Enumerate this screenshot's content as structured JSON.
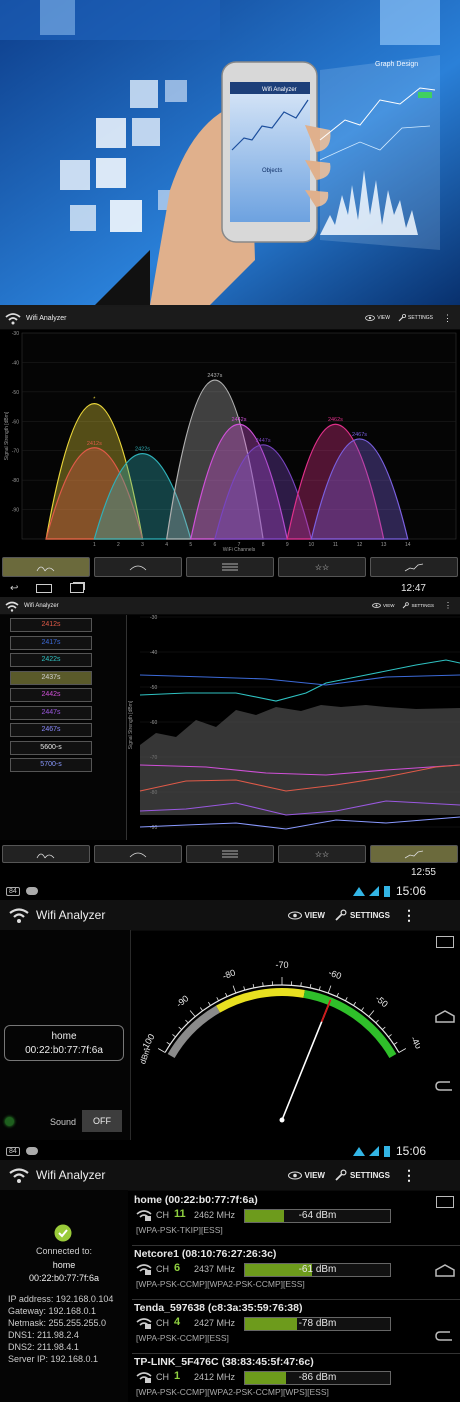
{
  "header_image": {
    "graph_design_label": "Graph Design",
    "screen_header": "Wifi Analyzer",
    "screen_label": "Objects"
  },
  "panel1": {
    "app_title": "Wifi Analyzer",
    "view_label": "VIEW",
    "settings_label": "SETTINGS",
    "ylabel": "Signal Strength [dBm]",
    "xlabel": "WiFi Channels",
    "time": "12:47"
  },
  "chart_data": {
    "type": "area",
    "title": "",
    "xlabel": "WiFi Channels",
    "ylabel": "Signal Strength [dBm]",
    "ylim": [
      -100,
      -30
    ],
    "xlim": [
      -2,
      16
    ],
    "x_ticks": [
      "1",
      "2",
      "3",
      "4",
      "5",
      "6",
      "7",
      "8",
      "9",
      "10",
      "11",
      "12",
      "13",
      "14"
    ],
    "y_ticks": [
      "-30",
      "-40",
      "-50",
      "-60",
      "-70",
      "-80",
      "-90"
    ],
    "series": [
      {
        "name": "*",
        "channel": 1,
        "peak": -54,
        "color": "#e8d43a"
      },
      {
        "name": "2412s",
        "channel": 1,
        "peak": -69,
        "color": "#e05a48"
      },
      {
        "name": "2422s",
        "channel": 3,
        "peak": -71,
        "color": "#2fb0b8"
      },
      {
        "name": "2437s",
        "channel": 6,
        "peak": -46,
        "color": "#b0b0b0"
      },
      {
        "name": "2442s",
        "channel": 7,
        "peak": -61,
        "color": "#d050d8"
      },
      {
        "name": "2447s",
        "channel": 8,
        "peak": -68,
        "color": "#7844c0"
      },
      {
        "name": "2462s",
        "channel": 11,
        "peak": -61,
        "color": "#e0308a"
      },
      {
        "name": "2467s",
        "channel": 12,
        "peak": -66,
        "color": "#7a60e0"
      }
    ]
  },
  "panel2": {
    "app_title": "Wifi Analyzer",
    "view_label": "VIEW",
    "settings_label": "SETTINGS",
    "ylabel": "Signal Strength [dBm]",
    "y_ticks": [
      "-30",
      "-40",
      "-50",
      "-60",
      "-70",
      "-80",
      "-90"
    ],
    "time": "12:55",
    "legend": [
      {
        "label": "2412s",
        "color": "#e05a48"
      },
      {
        "label": "2417s",
        "color": "#3c6ad8"
      },
      {
        "label": "2422s",
        "color": "#2fc2c2"
      },
      {
        "label": "2437s",
        "color": "#d0d0d0"
      },
      {
        "label": "2442s",
        "color": "#d050d8"
      },
      {
        "label": "2447s",
        "color": "#9a58e0"
      },
      {
        "label": "2467s",
        "color": "#8a8aff"
      },
      {
        "label": "5600-s",
        "color": "#e8e8e8"
      },
      {
        "label": "5700-s",
        "color": "#8a9aff"
      }
    ]
  },
  "panel3": {
    "app_title": "Wifi Analyzer",
    "view_label": "VIEW",
    "settings_label": "SETTINGS",
    "time": "15:06",
    "badge": "84",
    "ssid": "home",
    "bssid": "00:22:b0:77:7f:6a",
    "sound_label": "Sound",
    "sound_toggle": "OFF",
    "dbm_label": "dBm",
    "scale": [
      "-100",
      "-90",
      "-80",
      "-70",
      "-60",
      "-50",
      "-40"
    ],
    "needle_dbm": -59
  },
  "panel4": {
    "app_title": "Wifi Analyzer",
    "view_label": "VIEW",
    "settings_label": "SETTINGS",
    "time": "15:06",
    "badge": "84",
    "connected_label": "Connected to:",
    "connected_ssid": "home",
    "connected_bssid": "00:22:b0:77:7f:6a",
    "ip": "IP address: 192.168.0.104",
    "gateway": "Gateway: 192.168.0.1",
    "netmask": "Netmask: 255.255.255.0",
    "dns1": "DNS1: 211.98.2.4",
    "dns2": "DNS2: 211.98.4.1",
    "server": "Server IP: 192.168.0.1",
    "networks": [
      {
        "name": "home (00:22:b0:77:7f:6a)",
        "ch_label": "CH",
        "ch": "11",
        "freq": "2462 MHz",
        "dbm": "-64 dBm",
        "level": 0.27,
        "security": "[WPA-PSK-TKIP][ESS]"
      },
      {
        "name": "Netcore1 (08:10:76:27:26:3c)",
        "ch_label": "CH",
        "ch": "6",
        "freq": "2437 MHz",
        "dbm": "-61 dBm",
        "level": 0.46,
        "security": "[WPA-PSK-CCMP][WPA2-PSK-CCMP][ESS]"
      },
      {
        "name": "Tenda_597638 (c8:3a:35:59:76:38)",
        "ch_label": "CH",
        "ch": "4",
        "freq": "2427 MHz",
        "dbm": "-78 dBm",
        "level": 0.36,
        "security": "[WPA-PSK-CCMP][ESS]"
      },
      {
        "name": "TP-LINK_5F476C (38:83:45:5f:47:6c)",
        "ch_label": "CH",
        "ch": "1",
        "freq": "2412 MHz",
        "dbm": "-86 dBm",
        "level": 0.28,
        "security": "[WPA-PSK-CCMP][WPA2-PSK-CCMP][WPS][ESS]"
      }
    ]
  }
}
